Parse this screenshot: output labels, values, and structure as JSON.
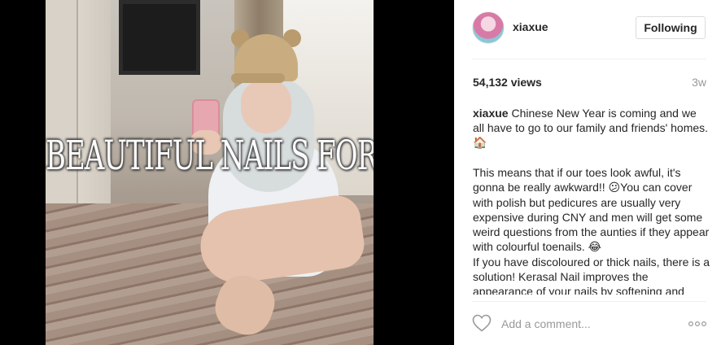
{
  "video": {
    "overlay_text": "BEAUTIFUL NAILS FOR CNY!"
  },
  "post": {
    "username": "xiaxue",
    "follow_button": "Following",
    "views": "54,132 views",
    "time_ago": "3w",
    "caption": {
      "author": "xiaxue",
      "p1": "Chinese New Year is coming and we all have to go to our family and friends' homes.",
      "p1_emoji": "🏠",
      "p2_a": "This means that if our toes look awful, it's gonna be really awkward!!",
      "p2_emoji1": "😕",
      "p2_b": "You can cover with polish but pedicures are usually very expensive during CNY and men will get some weird questions from the aunties if they appear with colourful toenails.",
      "p2_emoji2": "😂",
      "p3": "If you have discoloured or thick nails, there is a solution! Kerasal Nail improves the appearance of your nails by softening and"
    }
  },
  "comment": {
    "placeholder": "Add a comment..."
  },
  "icons": {
    "like": "heart-outline-icon",
    "more": "more-options-icon"
  },
  "colors": {
    "text": "#262626",
    "secondary": "#999999",
    "border": "#dbdbdb",
    "media_bg": "#000000"
  }
}
